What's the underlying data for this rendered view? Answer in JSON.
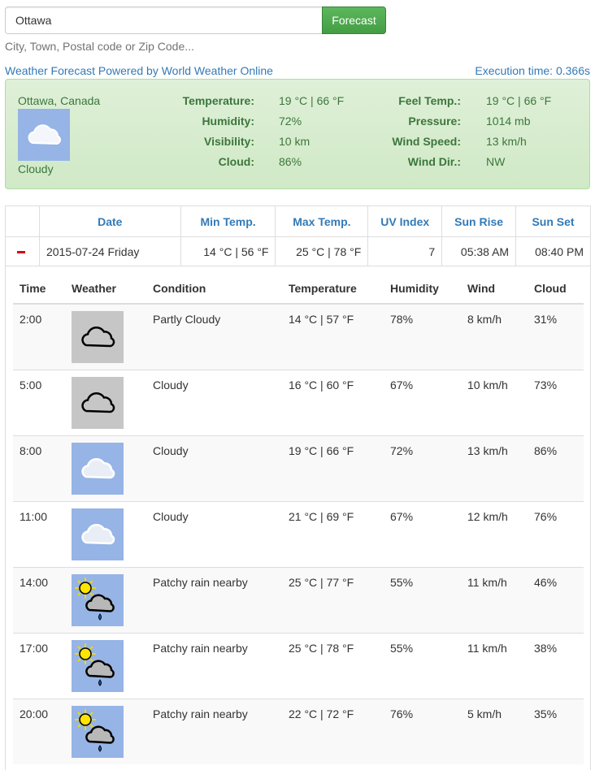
{
  "search": {
    "value": "Ottawa",
    "button_label": "Forecast",
    "help": "City, Town, Postal code or Zip Code..."
  },
  "powered_by": "Weather Forecast Powered by World Weather Online",
  "execution_time": "Execution time: 0.366s",
  "current": {
    "location": "Ottawa, Canada",
    "condition": "Cloudy",
    "icon": "cloud-icon",
    "labels": {
      "temperature": "Temperature:",
      "humidity": "Humidity:",
      "visibility": "Visibility:",
      "cloud": "Cloud:",
      "feel": "Feel Temp.:",
      "pressure": "Pressure:",
      "wind_speed": "Wind Speed:",
      "wind_dir": "Wind Dir.:"
    },
    "values": {
      "temperature": "19 °C | 66 °F",
      "humidity": "72%",
      "visibility": "10 km",
      "cloud": "86%",
      "feel": "19 °C | 66 °F",
      "pressure": "1014 mb",
      "wind_speed": "13 km/h",
      "wind_dir": "NW"
    }
  },
  "forecast": {
    "headers": [
      "Date",
      "Min Temp.",
      "Max Temp.",
      "UV Index",
      "Sun Rise",
      "Sun Set"
    ],
    "row": {
      "date": "2015-07-24 Friday",
      "min": "14 °C | 56 °F",
      "max": "25 °C | 78 °F",
      "uv": "7",
      "sunrise": "05:38 AM",
      "sunset": "08:40 PM"
    }
  },
  "hourly": {
    "headers": [
      "Time",
      "Weather",
      "Condition",
      "Temperature",
      "Humidity",
      "Wind",
      "Cloud"
    ],
    "rows": [
      {
        "time": "2:00",
        "icon": "night-cloud-icon",
        "condition": "Partly Cloudy",
        "temp": "14 °C | 57 °F",
        "humidity": "78%",
        "wind": "8 km/h",
        "cloud": "31%"
      },
      {
        "time": "5:00",
        "icon": "night-cloud-icon",
        "condition": "Cloudy",
        "temp": "16 °C | 60 °F",
        "humidity": "67%",
        "wind": "10 km/h",
        "cloud": "73%"
      },
      {
        "time": "8:00",
        "icon": "cloud-icon",
        "condition": "Cloudy",
        "temp": "19 °C | 66 °F",
        "humidity": "72%",
        "wind": "13 km/h",
        "cloud": "86%"
      },
      {
        "time": "11:00",
        "icon": "cloud-icon",
        "condition": "Cloudy",
        "temp": "21 °C | 69 °F",
        "humidity": "67%",
        "wind": "12 km/h",
        "cloud": "76%"
      },
      {
        "time": "14:00",
        "icon": "sun-rain-icon",
        "condition": "Patchy rain nearby",
        "temp": "25 °C | 77 °F",
        "humidity": "55%",
        "wind": "11 km/h",
        "cloud": "46%"
      },
      {
        "time": "17:00",
        "icon": "sun-rain-icon",
        "condition": "Patchy rain nearby",
        "temp": "25 °C | 78 °F",
        "humidity": "55%",
        "wind": "11 km/h",
        "cloud": "38%"
      },
      {
        "time": "20:00",
        "icon": "sun-rain-icon",
        "condition": "Patchy rain nearby",
        "temp": "22 °C | 72 °F",
        "humidity": "76%",
        "wind": "5 km/h",
        "cloud": "35%"
      }
    ]
  },
  "colors": {
    "link": "#337ab7",
    "success": "#5cb85c",
    "panel_bg": "#dff0d8",
    "panel_text": "#3c763d",
    "day_icon_bg": "#96b4e6",
    "night_icon_bg": "#c6c6c6"
  }
}
